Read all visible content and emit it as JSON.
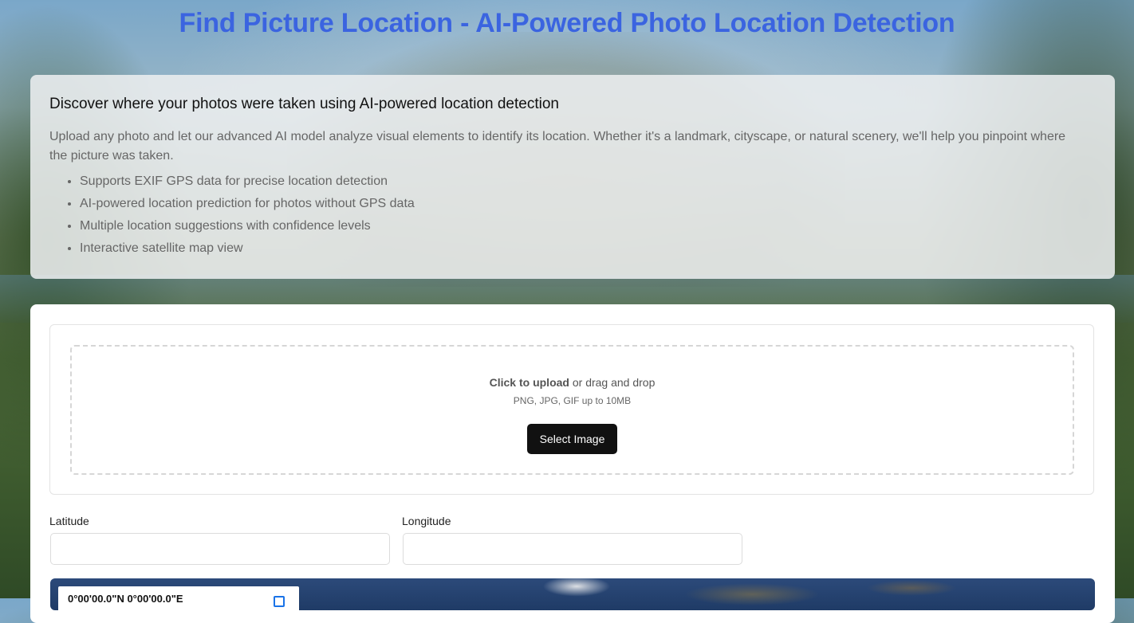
{
  "page_title": "Find Picture Location - AI-Powered Photo Location Detection",
  "info": {
    "heading": "Discover where your photos were taken using AI-powered location detection",
    "description": "Upload any photo and let our advanced AI model analyze visual elements to identify its location. Whether it's a landmark, cityscape, or natural scenery, we'll help you pinpoint where the picture was taken.",
    "features": [
      "Supports EXIF GPS data for precise location detection",
      "AI-powered location prediction for photos without GPS data",
      "Multiple location suggestions with confidence levels",
      "Interactive satellite map view"
    ]
  },
  "upload": {
    "click_text": "Click to upload",
    "drag_text": " or drag and drop",
    "hint": "PNG, JPG, GIF up to 10MB",
    "button_label": "Select Image"
  },
  "fields": {
    "latitude_label": "Latitude",
    "latitude_value": "",
    "longitude_label": "Longitude",
    "longitude_value": ""
  },
  "map": {
    "coordinates_text": "0°00'00.0\"N 0°00'00.0\"E"
  },
  "colors": {
    "title": "#3b64e0",
    "button_bg": "#111111"
  }
}
